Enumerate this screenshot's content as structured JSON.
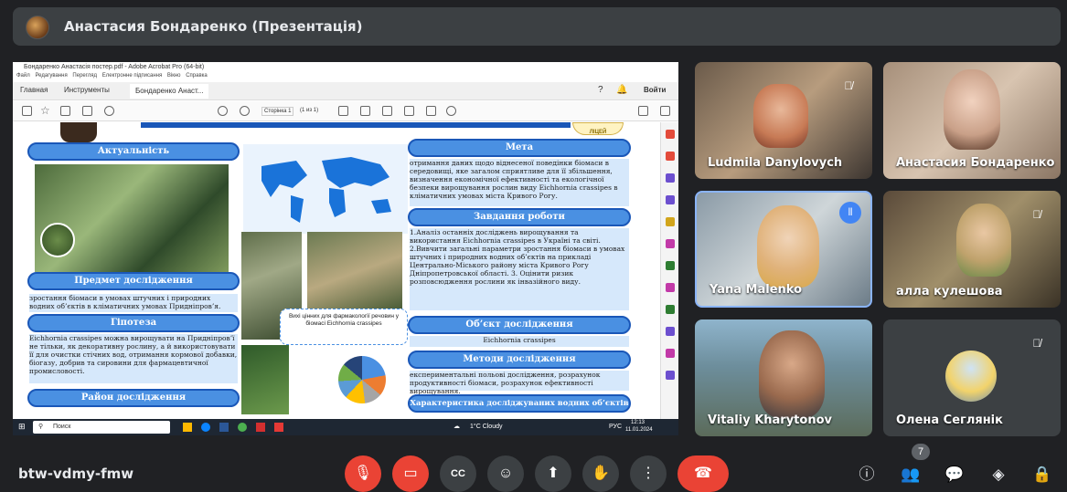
{
  "presenter": {
    "name": "Анастасия Бондаренко (Презентація)"
  },
  "acrobat": {
    "title": "Бондаренко Анастасія постер.pdf - Adobe Acrobat Pro (64-bit)",
    "menu": [
      "Файл",
      "Редагування",
      "Перегляд",
      "Електронне підписання",
      "Вікно",
      "Справка"
    ],
    "tabs": [
      "Главная",
      "Инструменты",
      "Бондаренко Анаст..."
    ],
    "signin": "Войти",
    "page_label": "Сторінка 1",
    "page_count": "(1 из 1)"
  },
  "poster": {
    "aktualnist": "Актуальність",
    "meta": "Мета",
    "meta_text": "отримання даних щодо віднесеної поведінки біомаси в середовищі, яке загалом сприятливе для її збільшення, визначення економічної ефективності та екологічної безпеки вирощування рослин виду Eichhornia crassipes в кліматичних умовах міста Кривого Рогу.",
    "zavdannia": "Завдання роботи",
    "zavdannia_text": "1.Аналіз останніх досліджень вирощування та використання Eichhornia crassipes в Україні та світі. 2.Вивчити загальні параметри зростання біомаси в умовах штучних і природних водних об’єктів на прикладі Центрально-Міського району міста Кривого Рогу Дніпропетровської області. 3. Оцінити ризик розповсюдження рослини як інвазійного виду.",
    "predmet": "Предмет дослідження",
    "predmet_text": "зростання біомаси в умовах штучних і природних водних об’єктів в кліматичних умовах Придніпров’я.",
    "hipoteza": "Гіпотеза",
    "hipoteza_text": "Eichhornia crassipes можна вирощувати на Придніпров’ї не тільки, як декоративну рослину, а й використовувати її для очистки стічних вод, отримання кормової добавки, біогазу, добрив та сировини для фармацевтичної промисловості.",
    "rayon": "Район дослідження",
    "caption": "Вихі цінних для фармакології речовин у біомасі Eichhornia crassipes",
    "obiekt": "Об’єкт дослідження",
    "obiekt_text": "Eichhornia crassipes",
    "metody": "Методи дослідження",
    "metody_text": "експериментальні польові дослідження, розрахунок продуктивності біомаси, розрахунок ефективності вирощування.",
    "kharakt": "Характеристика досліджуваних водних об’єктів",
    "liceum": "ЛІЦЕЙ"
  },
  "taskbar": {
    "search": "Поиск",
    "weather": "1°C Cloudy",
    "lang": "РУС",
    "time": "12:13",
    "date": "11.01.2024"
  },
  "participants": [
    {
      "name": "Ludmila Danylovych",
      "muted": true
    },
    {
      "name": "Анастасия Бондаренко",
      "muted": false
    },
    {
      "name": "Yana Malenko",
      "muted": false,
      "speaking": true
    },
    {
      "name": "алла кулешова",
      "muted": true
    },
    {
      "name": "Vitaliy Kharytonov",
      "muted": false
    },
    {
      "name": "Олена Сеглянік",
      "muted": true
    }
  ],
  "meeting": {
    "code": "btw-vdmy-fmw",
    "people_count": "7"
  },
  "colors": {
    "bg": "#202124",
    "tile": "#3c4043",
    "accent_red": "#ea4335",
    "poster_blue": "#4a90e2",
    "speaking": "#4285f4"
  },
  "controls": {
    "mic": "mic-off-icon",
    "cam": "camera-off-icon",
    "cc": "captions-icon",
    "emoji": "emoji-icon",
    "present": "present-icon",
    "hand": "raise-hand-icon",
    "more": "more-icon",
    "leave": "leave-call-icon"
  }
}
